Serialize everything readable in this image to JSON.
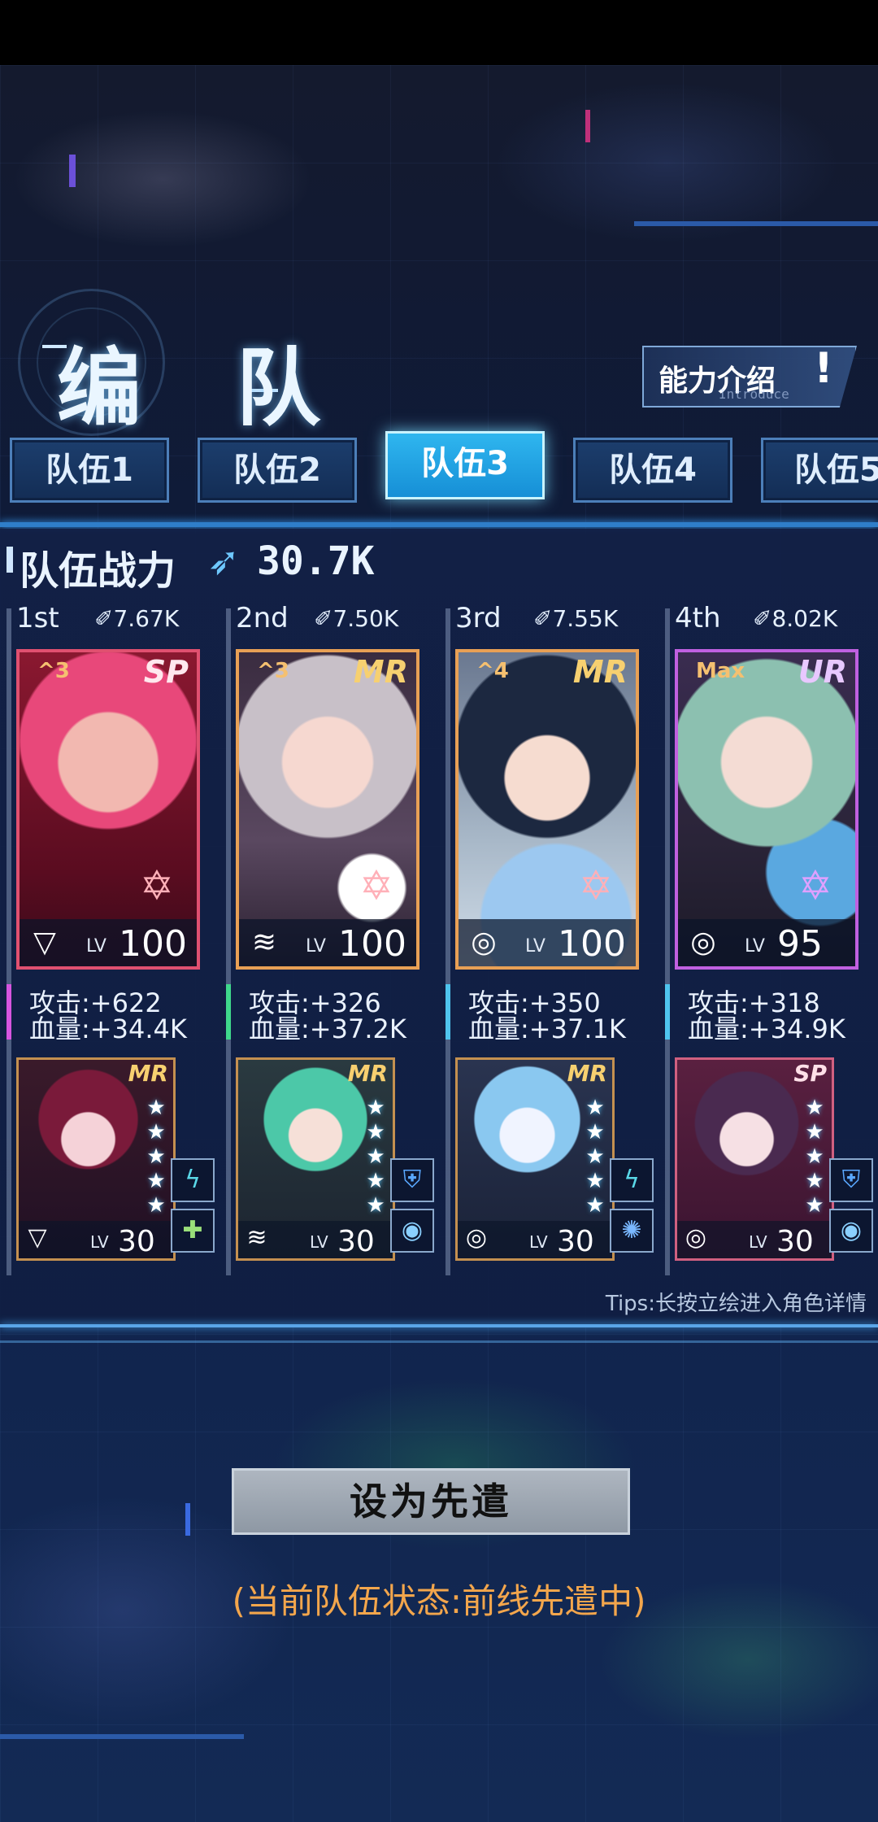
{
  "title": "编 队",
  "ability": {
    "label": "能力介绍",
    "sub": "Introduce",
    "icon": "exclamation-icon"
  },
  "tabs": [
    {
      "label": "队伍1",
      "active": false
    },
    {
      "label": "队伍2",
      "active": false
    },
    {
      "label": "队伍3",
      "active": true
    },
    {
      "label": "队伍4",
      "active": false
    },
    {
      "label": "队伍5",
      "active": false
    }
  ],
  "team_power": {
    "label": "队伍战力",
    "icon": "rocket-icon",
    "value": "30.7K"
  },
  "members": [
    {
      "rank": "1st",
      "power": "7.67K",
      "grade": "^3",
      "rarity": "SP",
      "element": "triangle-element-icon",
      "lv_label": "LV",
      "level": "100",
      "attack": "攻击:+622",
      "hp": "血量:+34.4K",
      "accent": "#d655e0",
      "sub": {
        "rarity": "MR",
        "stars": 5,
        "element": "triangle-element-icon",
        "lv_label": "LV",
        "level": "30",
        "skills": [
          "lightning-skill-icon",
          "cross-skill-icon"
        ]
      }
    },
    {
      "rank": "2nd",
      "power": "7.50K",
      "grade": "^3",
      "rarity": "MR",
      "element": "wifi-element-icon",
      "lv_label": "LV",
      "level": "100",
      "attack": "攻击:+326",
      "hp": "血量:+37.2K",
      "accent": "#3fd88c",
      "sub": {
        "rarity": "MR",
        "stars": 5,
        "element": "wifi-element-icon",
        "lv_label": "LV",
        "level": "30",
        "skills": [
          "shield-skill-icon",
          "eye-skill-icon"
        ]
      }
    },
    {
      "rank": "3rd",
      "power": "7.55K",
      "grade": "^4",
      "rarity": "MR",
      "element": "circle-element-icon",
      "lv_label": "LV",
      "level": "100",
      "attack": "攻击:+350",
      "hp": "血量:+37.1K",
      "accent": "#4fc4ee",
      "sub": {
        "rarity": "MR",
        "stars": 5,
        "element": "circle-element-icon",
        "lv_label": "LV",
        "level": "30",
        "skills": [
          "lightning-skill-icon",
          "burst-skill-icon"
        ]
      }
    },
    {
      "rank": "4th",
      "power": "8.02K",
      "grade": "Max",
      "rarity": "UR",
      "element": "circle-element-icon",
      "lv_label": "LV",
      "level": "95",
      "attack": "攻击:+318",
      "hp": "血量:+34.9K",
      "accent": "#4fc4ee",
      "sub": {
        "rarity": "SP",
        "stars": 5,
        "element": "circle-element-icon",
        "lv_label": "LV",
        "level": "30",
        "skills": [
          "shield-skill-icon",
          "eye-skill-icon"
        ]
      }
    }
  ],
  "tips": "Tips:长按立绘进入角色详情",
  "deploy_button": "设为先遣",
  "status": "(当前队伍状态:前线先遣中)"
}
